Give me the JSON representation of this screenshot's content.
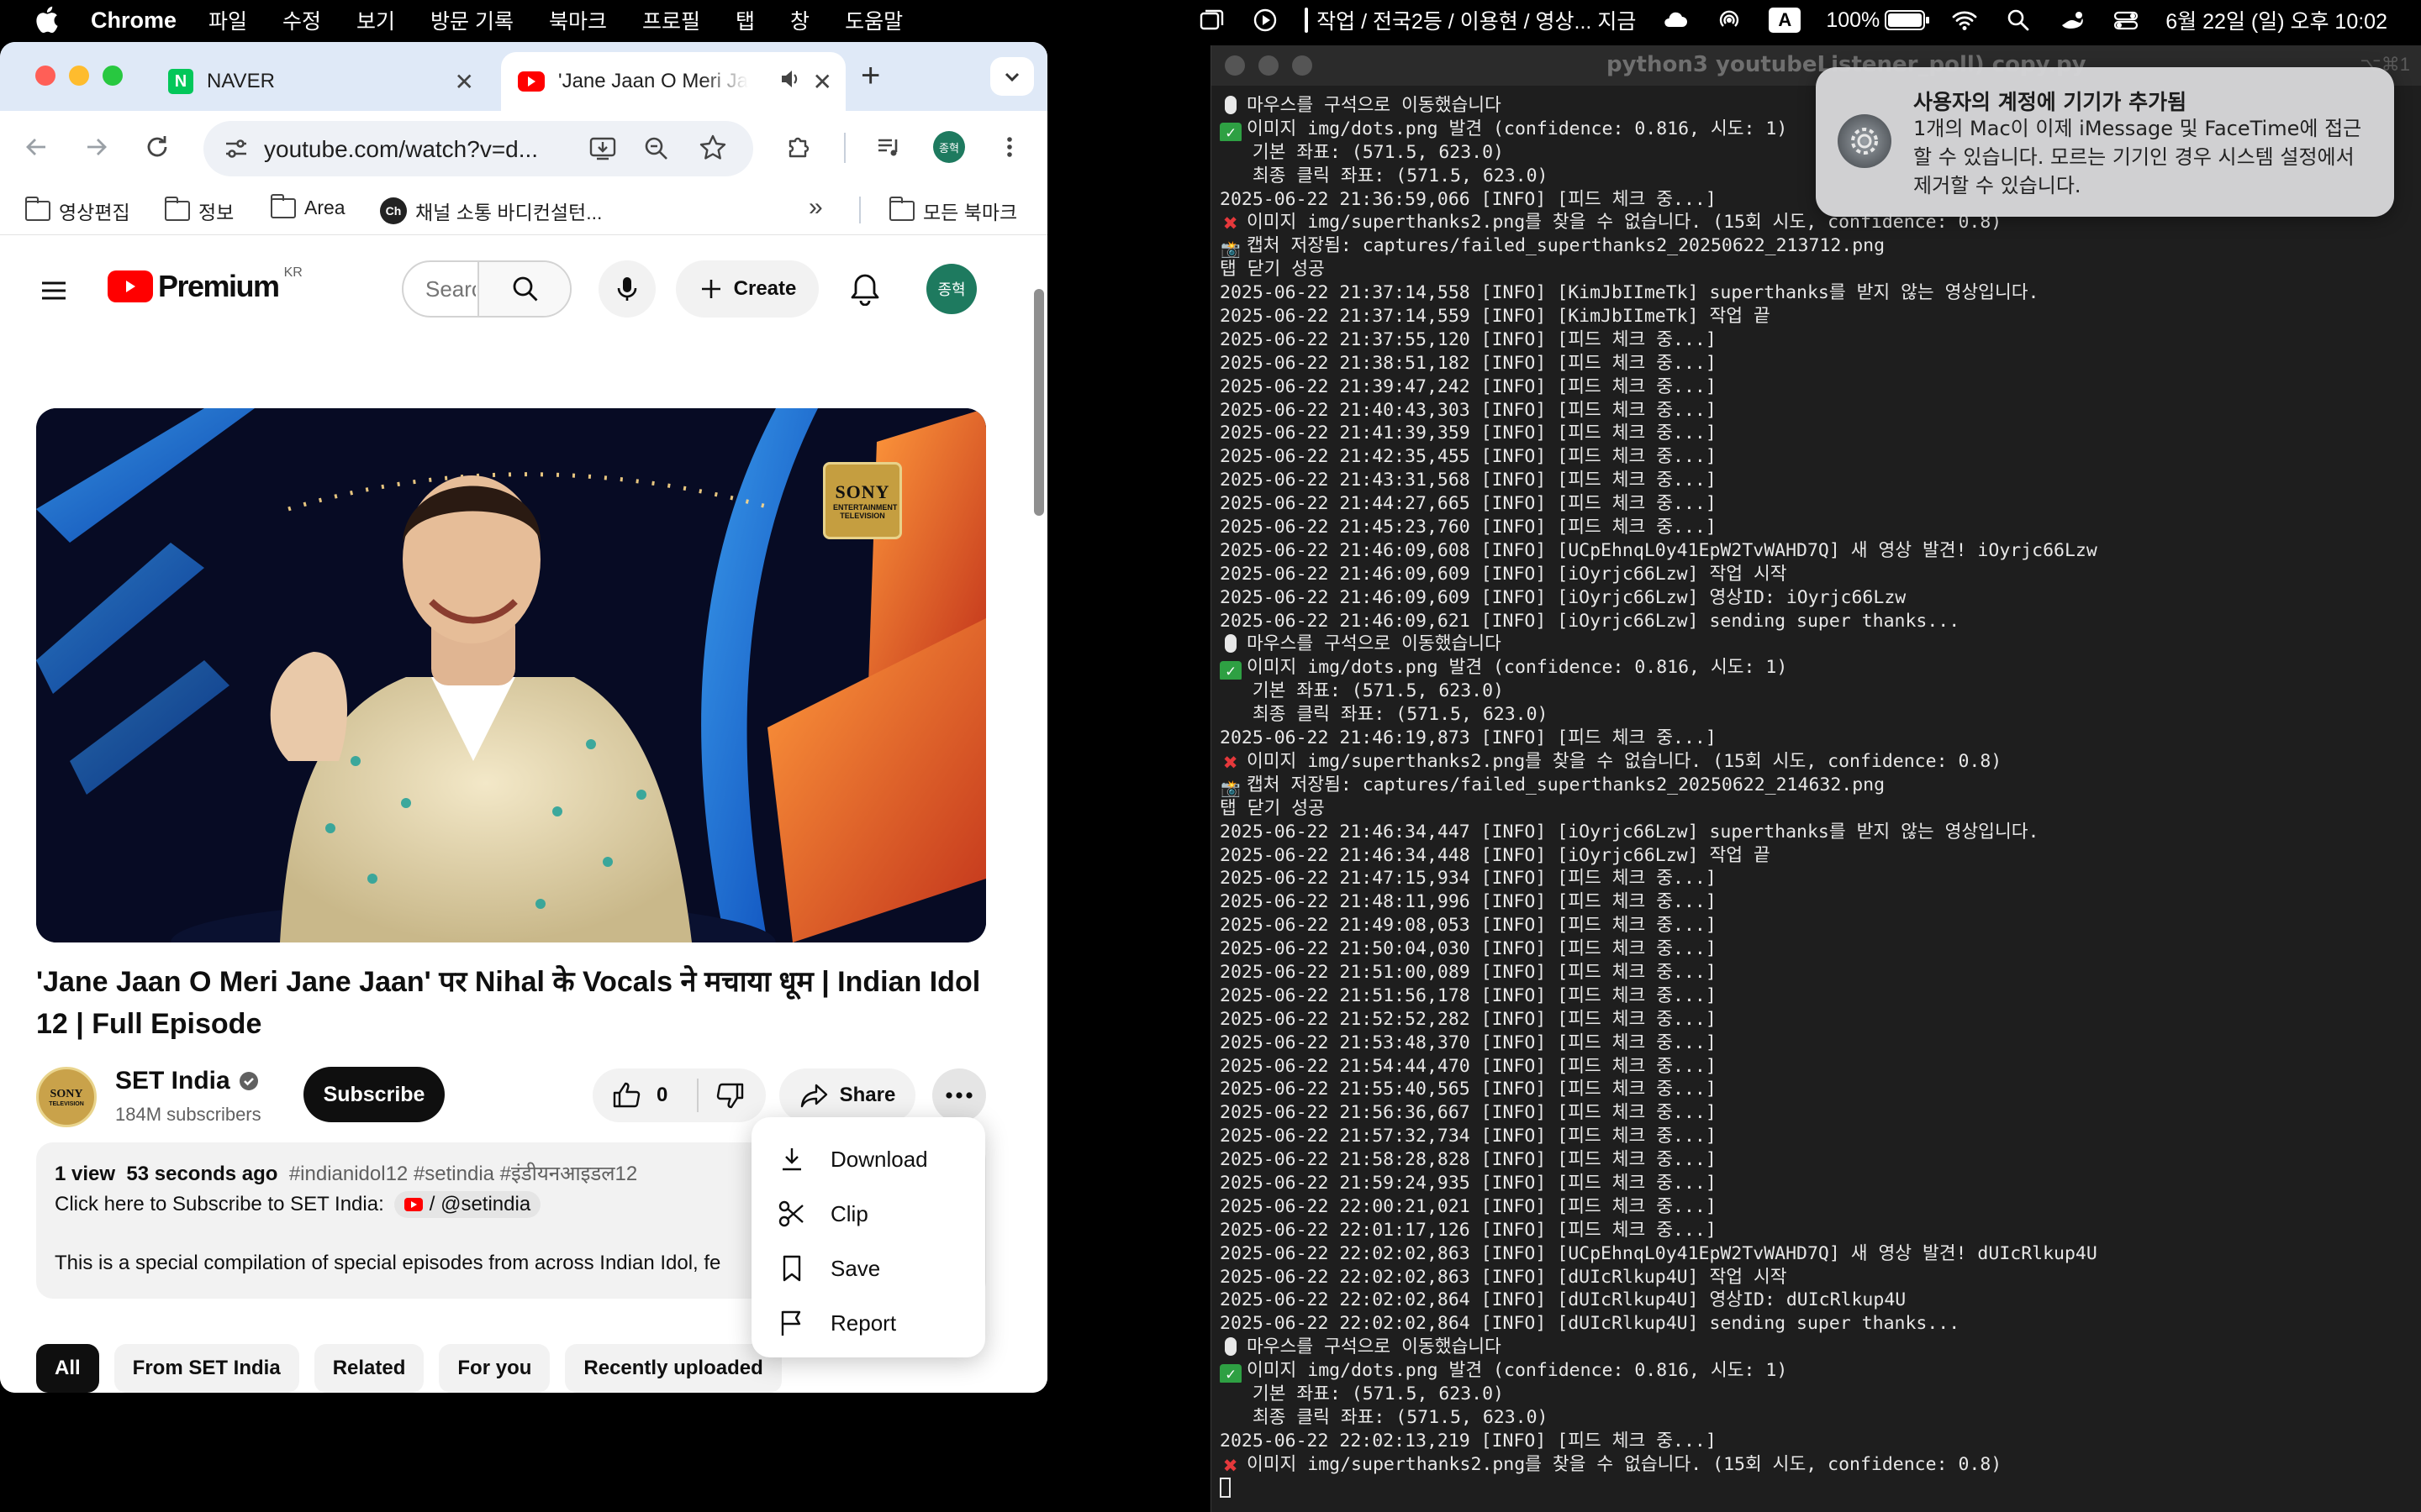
{
  "menubar": {
    "app_name": "Chrome",
    "menus": [
      "파일",
      "수정",
      "보기",
      "방문 기록",
      "북마크",
      "프로필",
      "탭",
      "창",
      "도움말"
    ],
    "now_playing": "작업 / 전국2등 / 이용현 / 영상... 지금",
    "battery": "100%",
    "input_source": "A",
    "datetime": "6월 22일 (일) 오후 10:02"
  },
  "browser": {
    "tabs": [
      {
        "title": "NAVER",
        "favicon": "naver-icon",
        "favicon_color": "#03c75a"
      },
      {
        "title": "'Jane Jaan O Meri Ja",
        "favicon": "youtube-icon",
        "favicon_color": "#ff0000"
      }
    ],
    "url": "youtube.com/watch?v=d...",
    "profile_initial": "종혁",
    "bookmarks": [
      "영상편집",
      "정보",
      "Area",
      "채널 소통 바디컨설턴...",
      "모든 북마크"
    ],
    "bookmark_ch_icon": "Ch"
  },
  "youtube": {
    "logo_text": "Premium",
    "region": "KR",
    "search_placeholder": "Search",
    "create_label": "Create",
    "avatar_initial": "종혁",
    "video": {
      "overlay_logo": "SONY",
      "overlay_sub": "ENTERTAINMENT TELEVISION",
      "title": "'Jane Jaan O Meri Jane Jaan' पर Nihal के Vocals ने मचाया धूम | Indian Idol 12 | Full Episode"
    },
    "channel": {
      "name": "SET India",
      "subscribers": "184M subscribers",
      "subscribe_label": "Subscribe",
      "avatar_text": "SONY",
      "avatar_sub": "TELEVISION"
    },
    "actions": {
      "likes": "0",
      "share_label": "Share"
    },
    "description": {
      "views": "1 view",
      "time": "53 seconds ago",
      "hashtags": "#indianidol12 #setindia #इंडीयनआइडल12",
      "subscribe_line": "Click here to Subscribe to SET India:",
      "handle": "/ @setindia",
      "body": "This is a special compilation of special episodes from across Indian Idol, fe"
    },
    "more_menu": [
      "Download",
      "Clip",
      "Save",
      "Report"
    ],
    "chips": [
      "All",
      "From SET India",
      "Related",
      "For you",
      "Recently uploaded"
    ],
    "accent": "#ff0000",
    "avatar_color": "#1e7a5f"
  },
  "terminal": {
    "title": "python3 youtubeListener_poll) copy.py",
    "lines": [
      {
        "m": "mouse",
        "t": "마우스를 구석으로 이동했습니다"
      },
      {
        "m": "check",
        "t": "이미지 img/dots.png 발견 (confidence: 0.816, 시도: 1)"
      },
      {
        "m": "",
        "t": "   기본 좌표: (571.5, 623.0)"
      },
      {
        "m": "",
        "t": "   최종 클릭 좌표: (571.5, 623.0)"
      },
      {
        "m": "",
        "t": "2025-06-22 21:36:59,066 [INFO] [피드 체크 중...]"
      },
      {
        "m": "x",
        "t": "이미지 img/superthanks2.png를 찾을 수 없습니다. (15회 시도, confidence: 0.8)"
      },
      {
        "m": "cam",
        "t": "캡처 저장됨: captures/failed_superthanks2_20250622_213712.png"
      },
      {
        "m": "",
        "t": "탭 닫기 성공"
      },
      {
        "m": "",
        "t": "2025-06-22 21:37:14,558 [INFO] [KimJbIImeTk] superthanks를 받지 않는 영상입니다."
      },
      {
        "m": "",
        "t": "2025-06-22 21:37:14,559 [INFO] [KimJbIImeTk] 작업 끝"
      },
      {
        "m": "",
        "t": "2025-06-22 21:37:55,120 [INFO] [피드 체크 중...]"
      },
      {
        "m": "",
        "t": "2025-06-22 21:38:51,182 [INFO] [피드 체크 중...]"
      },
      {
        "m": "",
        "t": "2025-06-22 21:39:47,242 [INFO] [피드 체크 중...]"
      },
      {
        "m": "",
        "t": "2025-06-22 21:40:43,303 [INFO] [피드 체크 중...]"
      },
      {
        "m": "",
        "t": "2025-06-22 21:41:39,359 [INFO] [피드 체크 중...]"
      },
      {
        "m": "",
        "t": "2025-06-22 21:42:35,455 [INFO] [피드 체크 중...]"
      },
      {
        "m": "",
        "t": "2025-06-22 21:43:31,568 [INFO] [피드 체크 중...]"
      },
      {
        "m": "",
        "t": "2025-06-22 21:44:27,665 [INFO] [피드 체크 중...]"
      },
      {
        "m": "",
        "t": "2025-06-22 21:45:23,760 [INFO] [피드 체크 중...]"
      },
      {
        "m": "",
        "t": "2025-06-22 21:46:09,608 [INFO] [UCpEhnqL0y41EpW2TvWAHD7Q] 새 영상 발견! iOyrjc66Lzw"
      },
      {
        "m": "",
        "t": "2025-06-22 21:46:09,609 [INFO] [iOyrjc66Lzw] 작업 시작"
      },
      {
        "m": "",
        "t": "2025-06-22 21:46:09,609 [INFO] [iOyrjc66Lzw] 영상ID: iOyrjc66Lzw"
      },
      {
        "m": "",
        "t": "2025-06-22 21:46:09,621 [INFO] [iOyrjc66Lzw] sending super thanks..."
      },
      {
        "m": "mouse",
        "t": "마우스를 구석으로 이동했습니다"
      },
      {
        "m": "check",
        "t": "이미지 img/dots.png 발견 (confidence: 0.816, 시도: 1)"
      },
      {
        "m": "",
        "t": "   기본 좌표: (571.5, 623.0)"
      },
      {
        "m": "",
        "t": "   최종 클릭 좌표: (571.5, 623.0)"
      },
      {
        "m": "",
        "t": "2025-06-22 21:46:19,873 [INFO] [피드 체크 중...]"
      },
      {
        "m": "x",
        "t": "이미지 img/superthanks2.png를 찾을 수 없습니다. (15회 시도, confidence: 0.8)"
      },
      {
        "m": "cam",
        "t": "캡처 저장됨: captures/failed_superthanks2_20250622_214632.png"
      },
      {
        "m": "",
        "t": "탭 닫기 성공"
      },
      {
        "m": "",
        "t": "2025-06-22 21:46:34,447 [INFO] [iOyrjc66Lzw] superthanks를 받지 않는 영상입니다."
      },
      {
        "m": "",
        "t": "2025-06-22 21:46:34,448 [INFO] [iOyrjc66Lzw] 작업 끝"
      },
      {
        "m": "",
        "t": "2025-06-22 21:47:15,934 [INFO] [피드 체크 중...]"
      },
      {
        "m": "",
        "t": "2025-06-22 21:48:11,996 [INFO] [피드 체크 중...]"
      },
      {
        "m": "",
        "t": "2025-06-22 21:49:08,053 [INFO] [피드 체크 중...]"
      },
      {
        "m": "",
        "t": "2025-06-22 21:50:04,030 [INFO] [피드 체크 중...]"
      },
      {
        "m": "",
        "t": "2025-06-22 21:51:00,089 [INFO] [피드 체크 중...]"
      },
      {
        "m": "",
        "t": "2025-06-22 21:51:56,178 [INFO] [피드 체크 중...]"
      },
      {
        "m": "",
        "t": "2025-06-22 21:52:52,282 [INFO] [피드 체크 중...]"
      },
      {
        "m": "",
        "t": "2025-06-22 21:53:48,370 [INFO] [피드 체크 중...]"
      },
      {
        "m": "",
        "t": "2025-06-22 21:54:44,470 [INFO] [피드 체크 중...]"
      },
      {
        "m": "",
        "t": "2025-06-22 21:55:40,565 [INFO] [피드 체크 중...]"
      },
      {
        "m": "",
        "t": "2025-06-22 21:56:36,667 [INFO] [피드 체크 중...]"
      },
      {
        "m": "",
        "t": "2025-06-22 21:57:32,734 [INFO] [피드 체크 중...]"
      },
      {
        "m": "",
        "t": "2025-06-22 21:58:28,828 [INFO] [피드 체크 중...]"
      },
      {
        "m": "",
        "t": "2025-06-22 21:59:24,935 [INFO] [피드 체크 중...]"
      },
      {
        "m": "",
        "t": "2025-06-22 22:00:21,021 [INFO] [피드 체크 중...]"
      },
      {
        "m": "",
        "t": "2025-06-22 22:01:17,126 [INFO] [피드 체크 중...]"
      },
      {
        "m": "",
        "t": "2025-06-22 22:02:02,863 [INFO] [UCpEhnqL0y41EpW2TvWAHD7Q] 새 영상 발견! dUIcRlkup4U"
      },
      {
        "m": "",
        "t": "2025-06-22 22:02:02,863 [INFO] [dUIcRlkup4U] 작업 시작"
      },
      {
        "m": "",
        "t": "2025-06-22 22:02:02,864 [INFO] [dUIcRlkup4U] 영상ID: dUIcRlkup4U"
      },
      {
        "m": "",
        "t": "2025-06-22 22:02:02,864 [INFO] [dUIcRlkup4U] sending super thanks..."
      },
      {
        "m": "mouse",
        "t": "마우스를 구석으로 이동했습니다"
      },
      {
        "m": "check",
        "t": "이미지 img/dots.png 발견 (confidence: 0.816, 시도: 1)"
      },
      {
        "m": "",
        "t": "   기본 좌표: (571.5, 623.0)"
      },
      {
        "m": "",
        "t": "   최종 클릭 좌표: (571.5, 623.0)"
      },
      {
        "m": "",
        "t": "2025-06-22 22:02:13,219 [INFO] [피드 체크 중...]"
      },
      {
        "m": "x",
        "t": "이미지 img/superthanks2.png를 찾을 수 없습니다. (15회 시도, confidence: 0.8)"
      }
    ]
  },
  "notification": {
    "title": "사용자의 계정에 기기가 추가됨",
    "body": "1개의 Mac이 이제 iMessage 및 FaceTime에 접근할 수 있습니다. 모르는 기기인 경우 시스템 설정에서 제거할 수 있습니다."
  }
}
